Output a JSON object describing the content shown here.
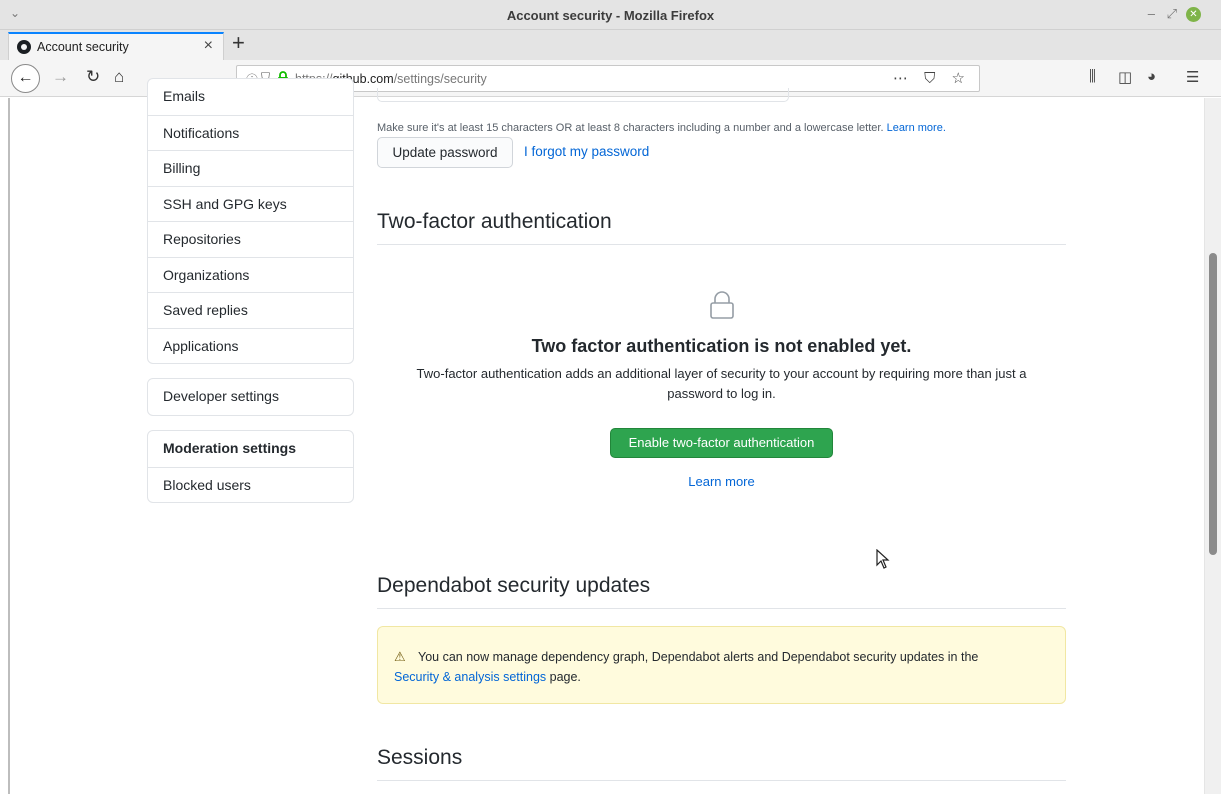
{
  "window": {
    "title": "Account security - Mozilla Firefox"
  },
  "tab": {
    "label": "Account security",
    "close": "×",
    "new_tab": "+"
  },
  "url": {
    "prefix": "https://",
    "domain": "github.com",
    "path": "/settings/security"
  },
  "sidebar": {
    "main_items": [
      "Emails",
      "Notifications",
      "Billing",
      "SSH and GPG keys",
      "Repositories",
      "Organizations",
      "Saved replies",
      "Applications"
    ],
    "developer_settings": "Developer settings",
    "moderation_heading": "Moderation settings",
    "blocked_users": "Blocked users"
  },
  "password": {
    "hint": "Make sure it's at least 15 characters OR at least 8 characters including a number and a lowercase letter.",
    "hint_link": "Learn more.",
    "update_button": "Update password",
    "forgot_link": "I forgot my password"
  },
  "two_factor": {
    "title": "Two-factor authentication",
    "heading": "Two factor authentication is not enabled yet.",
    "description": "Two-factor authentication adds an additional layer of security to your account by requiring more than just a password to log in.",
    "enable_button": "Enable two-factor authentication",
    "learn_more": "Learn more"
  },
  "dependabot": {
    "title": "Dependabot security updates",
    "message": "You can now manage dependency graph, Dependabot alerts and Dependabot security updates in the",
    "link": "Security & analysis settings",
    "suffix": " page."
  },
  "sessions": {
    "title": "Sessions"
  },
  "colors": {
    "accent_link": "#0366d6",
    "primary_button": "#2ea44f",
    "warning_bg": "#fffbdd"
  }
}
